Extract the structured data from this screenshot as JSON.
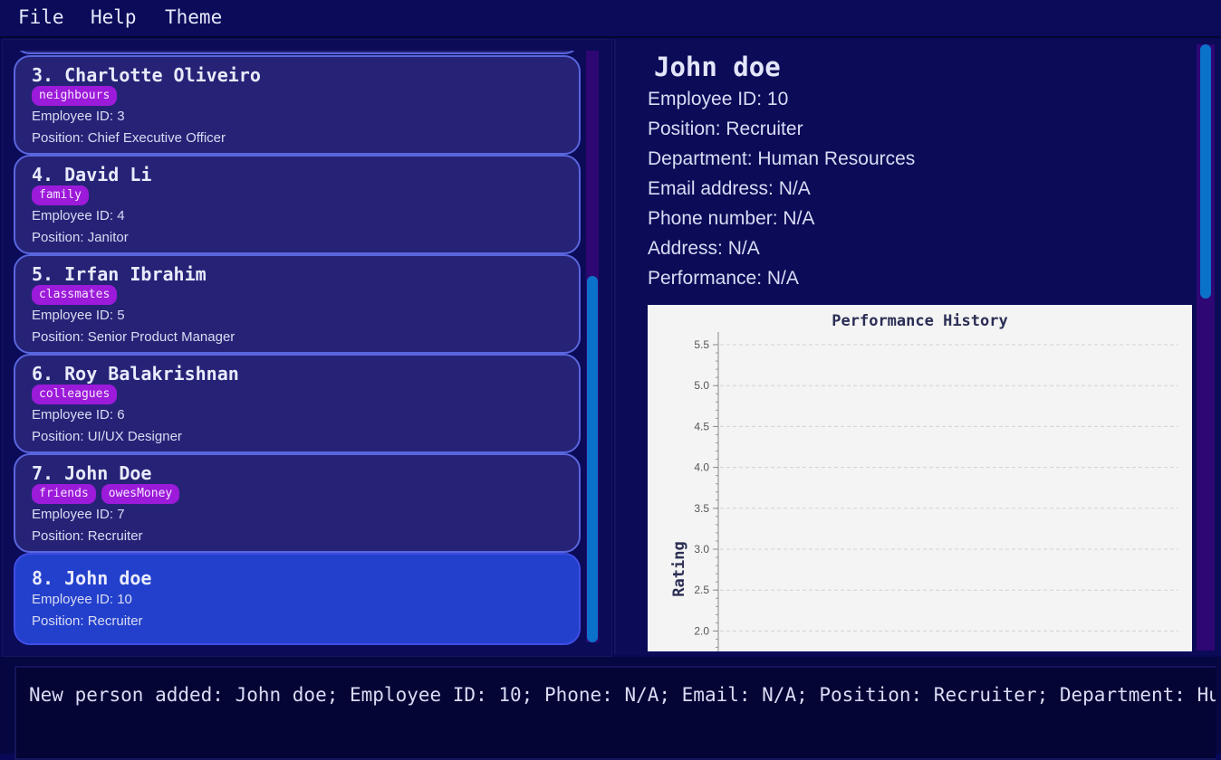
{
  "menu": {
    "file": "File",
    "help": "Help",
    "theme": "Theme"
  },
  "person_list": [
    {
      "name": "3.  Charlotte Oliveiro",
      "tags": [
        "neighbours"
      ],
      "employee_id": "Employee ID:  3",
      "position": "Position:  Chief Executive Officer"
    },
    {
      "name": "4.  David Li",
      "tags": [
        "family"
      ],
      "employee_id": "Employee ID:  4",
      "position": "Position:  Janitor"
    },
    {
      "name": "5.  Irfan Ibrahim",
      "tags": [
        "classmates"
      ],
      "employee_id": "Employee ID:  5",
      "position": "Position:  Senior Product Manager"
    },
    {
      "name": "6.  Roy Balakrishnan",
      "tags": [
        "colleagues"
      ],
      "employee_id": "Employee ID:  6",
      "position": "Position:  UI/UX Designer"
    },
    {
      "name": "7.  John Doe",
      "tags": [
        "friends",
        "owesMoney"
      ],
      "employee_id": "Employee ID:  7",
      "position": "Position:  Recruiter"
    },
    {
      "name": "8.  John doe",
      "tags": [],
      "employee_id": "Employee ID:  10",
      "position": "Position:  Recruiter",
      "selected": true
    }
  ],
  "list_scroll": {
    "thumb_start_fraction": 0.38,
    "thumb_size_fraction": 0.62
  },
  "detail": {
    "name": "John doe",
    "employee_id": "Employee ID:  10",
    "position": "Position:  Recruiter",
    "department": "Department:  Human Resources",
    "email": "Email address:  N/A",
    "phone": "Phone number:  N/A",
    "address": "Address:  N/A",
    "performance": "Performance: N/A"
  },
  "detail_scroll": {
    "thumb_start_fraction": 0.0,
    "thumb_size_fraction": 0.42
  },
  "chart_data": {
    "type": "line",
    "title": "Performance History",
    "ylabel": "Rating",
    "xlabel": "",
    "series": [],
    "ylim_visible": [
      2.0,
      5.5
    ],
    "y_ticks": [
      "5.5",
      "5.0",
      "4.5",
      "4.0",
      "3.5",
      "3.0",
      "2.5",
      "2.0"
    ],
    "grid": true
  },
  "result": "New person added: John doe; Employee ID: 10; Phone: N/A; Email: N/A; Position: Recruiter; Department: Human Resources"
}
